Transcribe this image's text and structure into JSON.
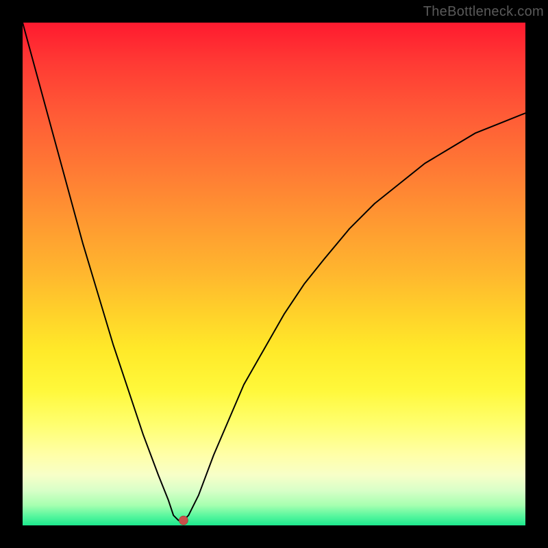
{
  "watermark": "TheBottleneck.com",
  "colors": {
    "curve": "#000000",
    "dot_fill": "#c94f4a",
    "dot_stroke": "#8a2d2d"
  },
  "chart_data": {
    "type": "line",
    "title": "",
    "xlabel": "",
    "ylabel": "",
    "xlim": [
      0,
      100
    ],
    "ylim": [
      0,
      100
    ],
    "grid": false,
    "legend": false,
    "series": [
      {
        "name": "bottleneck-curve",
        "x": [
          0,
          3,
          6,
          9,
          12,
          15,
          18,
          21,
          24,
          27,
          29,
          30,
          31,
          32,
          33,
          35,
          38,
          41,
          44,
          48,
          52,
          56,
          60,
          65,
          70,
          75,
          80,
          85,
          90,
          95,
          100
        ],
        "values": [
          100,
          89,
          78,
          67,
          56,
          46,
          36,
          27,
          18,
          10,
          5,
          2,
          1,
          1,
          2,
          6,
          14,
          21,
          28,
          35,
          42,
          48,
          53,
          59,
          64,
          68,
          72,
          75,
          78,
          80,
          82
        ]
      }
    ],
    "annotations": [
      {
        "kind": "marker",
        "name": "optimal-point",
        "x": 32,
        "y": 1
      }
    ]
  }
}
